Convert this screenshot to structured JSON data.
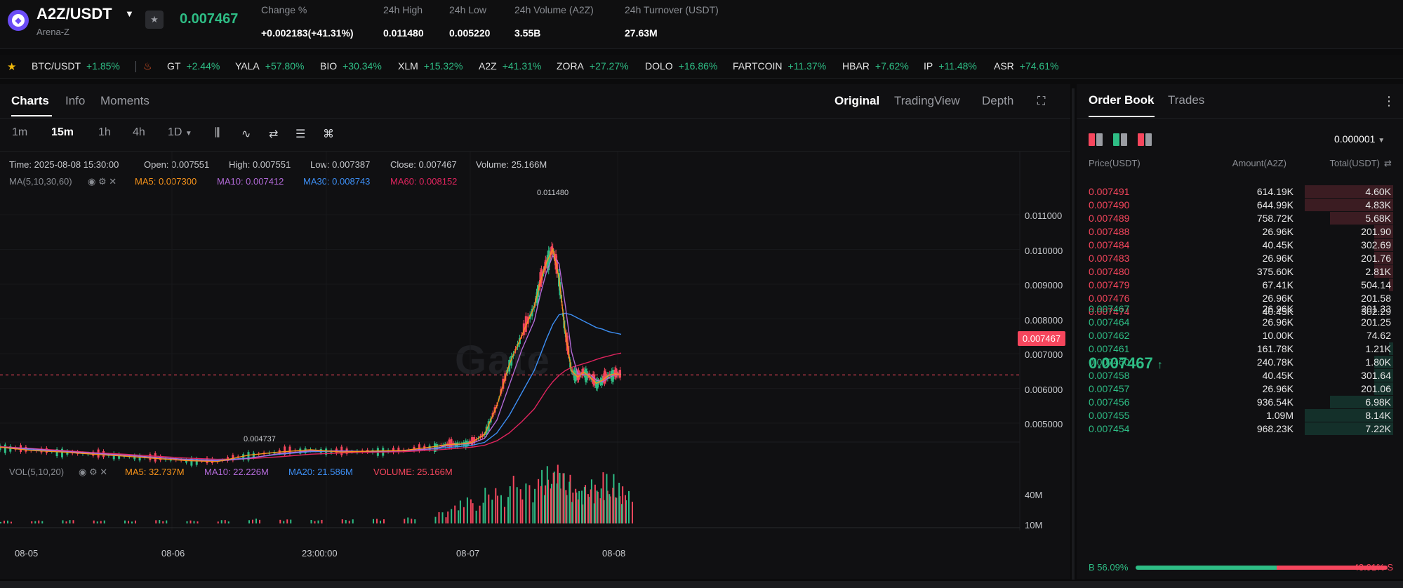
{
  "header": {
    "pair": "A2Z/USDT",
    "project": "Arena-Z",
    "last_price": "0.007467",
    "stats": [
      {
        "label": "Change %",
        "value": "+0.002183(+41.31%)",
        "tone": "up"
      },
      {
        "label": "24h High",
        "value": "0.011480",
        "tone": "plain"
      },
      {
        "label": "24h Low",
        "value": "0.005220",
        "tone": "plain"
      },
      {
        "label": "24h Volume (A2Z)",
        "value": "3.55B",
        "tone": "plain"
      },
      {
        "label": "24h Turnover (USDT)",
        "value": "27.63M",
        "tone": "plain"
      }
    ]
  },
  "ticker": [
    {
      "symbol": "BTC/USDT",
      "change": "+1.85%"
    },
    {
      "symbol": "GT",
      "change": "+2.44%"
    },
    {
      "symbol": "YALA",
      "change": "+57.80%"
    },
    {
      "symbol": "BIO",
      "change": "+30.34%"
    },
    {
      "symbol": "XLM",
      "change": "+15.32%"
    },
    {
      "symbol": "A2Z",
      "change": "+41.31%"
    },
    {
      "symbol": "ZORA",
      "change": "+27.27%"
    },
    {
      "symbol": "DOLO",
      "change": "+16.86%"
    },
    {
      "symbol": "FARTCOIN",
      "change": "+11.37%"
    },
    {
      "symbol": "HBAR",
      "change": "+7.62%"
    },
    {
      "symbol": "IP",
      "change": "+11.48%"
    },
    {
      "symbol": "ASR",
      "change": "+74.61%"
    }
  ],
  "chart_panel": {
    "tabs": [
      "Charts",
      "Info",
      "Moments"
    ],
    "view_tabs": [
      "Original",
      "TradingView",
      "Depth"
    ],
    "intervals": [
      "1m",
      "15m",
      "1h",
      "4h",
      "1D"
    ],
    "active_interval": "15m",
    "ohlc": {
      "time": "Time: 2025-08-08 15:30:00",
      "open": "Open: 0.007551",
      "high": "High: 0.007551",
      "low": "Low: 0.007387",
      "close": "Close: 0.007467",
      "volume": "Volume: 25.166M"
    },
    "ma_indicator": {
      "label": "MA(5,10,30,60)",
      "items": [
        {
          "text": "MA5: 0.007300",
          "color": "#f7931a"
        },
        {
          "text": "MA10: 0.007412",
          "color": "#b26ad8"
        },
        {
          "text": "MA30: 0.008743",
          "color": "#3d8ff5"
        },
        {
          "text": "MA60: 0.008152",
          "color": "#e0245e"
        }
      ]
    },
    "vol_indicator": {
      "label": "VOL(5,10,20)",
      "items": [
        {
          "text": "MA5: 32.737M",
          "color": "#f7931a"
        },
        {
          "text": "MA10: 22.226M",
          "color": "#b26ad8"
        },
        {
          "text": "MA20: 21.586M",
          "color": "#3d8ff5"
        },
        {
          "text": "VOLUME: 25.166M",
          "color": "#f6465d"
        }
      ]
    },
    "watermark": "Gate",
    "current_price_tag": "0.007467",
    "annotations": {
      "high": "0.011480",
      "low": "0.004737"
    }
  },
  "chart_data": {
    "type": "line",
    "x_ticks": [
      "08-05",
      "08-06",
      "23:00:00",
      "08-07",
      "08-08"
    ],
    "y_ticks": [
      "0.011000",
      "0.010000",
      "0.009000",
      "0.008000",
      "0.007000",
      "0.006000",
      "0.005000"
    ],
    "ylim": [
      0.00435,
      0.0122
    ],
    "volume_ticks": [
      "40M",
      "10M"
    ],
    "price_x": [
      0,
      0.05,
      0.1,
      0.15,
      0.2,
      0.25,
      0.3,
      0.35,
      0.4,
      0.45,
      0.5,
      0.55,
      0.6,
      0.65,
      0.7,
      0.72,
      0.74,
      0.76,
      0.78,
      0.8,
      0.82,
      0.84,
      0.86,
      0.87,
      0.88,
      0.89,
      0.9,
      0.91,
      0.92,
      0.93,
      0.94,
      0.95,
      0.96,
      0.97,
      0.98,
      0.99,
      1.0
    ],
    "close": [
      0.0052,
      0.0051,
      0.00505,
      0.00498,
      0.00492,
      0.00485,
      0.00478,
      0.00475,
      0.00495,
      0.00505,
      0.00512,
      0.00505,
      0.00508,
      0.0051,
      0.00522,
      0.00528,
      0.0053,
      0.00535,
      0.0056,
      0.0065,
      0.0078,
      0.0087,
      0.0096,
      0.0104,
      0.011,
      0.0114,
      0.0105,
      0.0088,
      0.0076,
      0.0074,
      0.00755,
      0.0074,
      0.0072,
      0.0073,
      0.00745,
      0.0075,
      0.007467
    ],
    "ma30": [
      0.0052,
      0.00512,
      0.00506,
      0.005,
      0.00495,
      0.00488,
      0.00482,
      0.00479,
      0.00486,
      0.00498,
      0.00506,
      0.00507,
      0.00507,
      0.00509,
      0.00515,
      0.00519,
      0.00522,
      0.00526,
      0.00535,
      0.00565,
      0.0062,
      0.0069,
      0.0076,
      0.0081,
      0.0086,
      0.00905,
      0.00935,
      0.0094,
      0.00935,
      0.00925,
      0.00915,
      0.00905,
      0.00895,
      0.0089,
      0.00882,
      0.00878,
      0.00874
    ],
    "ma60": [
      0.00522,
      0.00516,
      0.0051,
      0.00503,
      0.00498,
      0.00492,
      0.00486,
      0.00482,
      0.00484,
      0.0049,
      0.00498,
      0.00502,
      0.00504,
      0.00506,
      0.00511,
      0.00514,
      0.00517,
      0.0052,
      0.00526,
      0.0054,
      0.00565,
      0.006,
      0.0064,
      0.0067,
      0.007,
      0.00725,
      0.00745,
      0.0076,
      0.0077,
      0.00776,
      0.00782,
      0.00788,
      0.00795,
      0.00801,
      0.00806,
      0.00811,
      0.00815
    ],
    "volume_rel": [
      0.05,
      0.05,
      0.06,
      0.05,
      0.05,
      0.06,
      0.05,
      0.06,
      0.08,
      0.07,
      0.06,
      0.07,
      0.08,
      0.1,
      0.2,
      0.3,
      0.45,
      0.35,
      0.6,
      0.5,
      0.8,
      0.7,
      0.9,
      0.75,
      1.0,
      0.85,
      0.9,
      0.7,
      0.6,
      0.65,
      0.75,
      0.6,
      0.55,
      0.9,
      0.6,
      0.7,
      0.55
    ]
  },
  "order_book": {
    "tabs": [
      "Order Book",
      "Trades"
    ],
    "precision": "0.000001",
    "columns": [
      "Price(USDT)",
      "Amount(A2Z)",
      "Total(USDT)"
    ],
    "asks": [
      {
        "price": "0.007491",
        "amount": "614.19K",
        "total": "4.60K",
        "depth": 0.42
      },
      {
        "price": "0.007490",
        "amount": "644.99K",
        "total": "4.83K",
        "depth": 0.42
      },
      {
        "price": "0.007489",
        "amount": "758.72K",
        "total": "5.68K",
        "depth": 0.3
      },
      {
        "price": "0.007488",
        "amount": "26.96K",
        "total": "201.90",
        "depth": 0.09
      },
      {
        "price": "0.007484",
        "amount": "40.45K",
        "total": "302.69",
        "depth": 0.09
      },
      {
        "price": "0.007483",
        "amount": "26.96K",
        "total": "201.76",
        "depth": 0.09
      },
      {
        "price": "0.007480",
        "amount": "375.60K",
        "total": "2.81K",
        "depth": 0.09
      },
      {
        "price": "0.007479",
        "amount": "67.41K",
        "total": "504.14",
        "depth": 0.02
      },
      {
        "price": "0.007476",
        "amount": "26.96K",
        "total": "201.58",
        "depth": 0.0
      },
      {
        "price": "0.007474",
        "amount": "40.45K",
        "total": "302.29",
        "depth": 0.0
      }
    ],
    "mid_price": "0.007467",
    "bids": [
      {
        "price": "0.007467",
        "amount": "26.96K",
        "total": "201.33",
        "depth": 0.0
      },
      {
        "price": "0.007464",
        "amount": "26.96K",
        "total": "201.25",
        "depth": 0.0
      },
      {
        "price": "0.007462",
        "amount": "10.00K",
        "total": "74.62",
        "depth": 0.0
      },
      {
        "price": "0.007461",
        "amount": "161.78K",
        "total": "1.21K",
        "depth": 0.02
      },
      {
        "price": "0.007460",
        "amount": "240.78K",
        "total": "1.80K",
        "depth": 0.09
      },
      {
        "price": "0.007458",
        "amount": "40.45K",
        "total": "301.64",
        "depth": 0.09
      },
      {
        "price": "0.007457",
        "amount": "26.96K",
        "total": "201.06",
        "depth": 0.09
      },
      {
        "price": "0.007456",
        "amount": "936.54K",
        "total": "6.98K",
        "depth": 0.3
      },
      {
        "price": "0.007455",
        "amount": "1.09M",
        "total": "8.14K",
        "depth": 0.42
      },
      {
        "price": "0.007454",
        "amount": "968.23K",
        "total": "7.22K",
        "depth": 0.42
      }
    ],
    "buy_ratio": "B 56.09%",
    "sell_ratio": "43.91% S",
    "buy_fraction": 0.5609
  }
}
